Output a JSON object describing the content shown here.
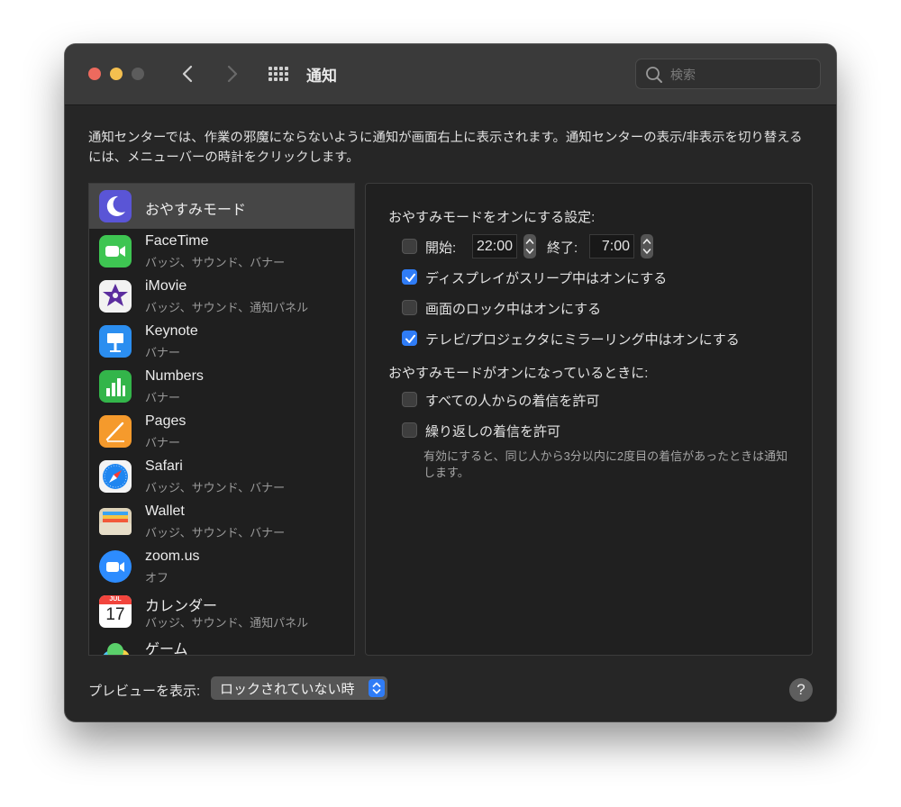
{
  "window": {
    "title": "通知"
  },
  "search": {
    "placeholder": "検索"
  },
  "description": "通知センターでは、作業の邪魔にならないように通知が画面右上に表示されます。通知センターの表示/非表示を切り替えるには、メニューバーの時計をクリックします。",
  "sidebar": {
    "items": [
      {
        "name": "おやすみモード",
        "subtitle": "",
        "icon": "moon-icon",
        "selected": true
      },
      {
        "name": "FaceTime",
        "subtitle": "バッジ、サウンド、バナー",
        "icon": "facetime-icon"
      },
      {
        "name": "iMovie",
        "subtitle": "バッジ、サウンド、通知パネル",
        "icon": "imovie-icon"
      },
      {
        "name": "Keynote",
        "subtitle": "バナー",
        "icon": "keynote-icon"
      },
      {
        "name": "Numbers",
        "subtitle": "バナー",
        "icon": "numbers-icon"
      },
      {
        "name": "Pages",
        "subtitle": "バナー",
        "icon": "pages-icon"
      },
      {
        "name": "Safari",
        "subtitle": "バッジ、サウンド、バナー",
        "icon": "safari-icon"
      },
      {
        "name": "Wallet",
        "subtitle": "バッジ、サウンド、バナー",
        "icon": "wallet-icon"
      },
      {
        "name": "zoom.us",
        "subtitle": "オフ",
        "icon": "zoom-icon"
      },
      {
        "name": "カレンダー",
        "subtitle": "バッジ、サウンド、通知パネル",
        "icon": "calendar-icon",
        "icon_text": {
          "month": "JUL",
          "day": "17"
        }
      },
      {
        "name": "ゲーム",
        "subtitle": "",
        "icon": "game-center-icon"
      }
    ]
  },
  "dnd": {
    "heading": "おやすみモードをオンにする設定:",
    "schedule": {
      "start_label": "開始:",
      "start_time": "22:00",
      "end_label": "終了:",
      "end_time": "7:00",
      "checked": false
    },
    "options": [
      {
        "label": "ディスプレイがスリープ中はオンにする",
        "checked": true
      },
      {
        "label": "画面のロック中はオンにする",
        "checked": false
      },
      {
        "label": "テレビ/プロジェクタにミラーリング中はオンにする",
        "checked": true
      }
    ],
    "when_on_heading": "おやすみモードがオンになっているときに:",
    "when_on_options": [
      {
        "label": "すべての人からの着信を許可",
        "checked": false
      },
      {
        "label": "繰り返しの着信を許可",
        "checked": false
      }
    ],
    "note": "有効にすると、同じ人から3分以内に2度目の着信があったときは通知します。"
  },
  "footer": {
    "preview_label": "プレビューを表示:",
    "preview_value": "ロックされていない時",
    "help": "?"
  },
  "colors": {
    "accent": "#2f7cf6",
    "close": "#ed6a5e",
    "minimize": "#f4bf4f"
  }
}
